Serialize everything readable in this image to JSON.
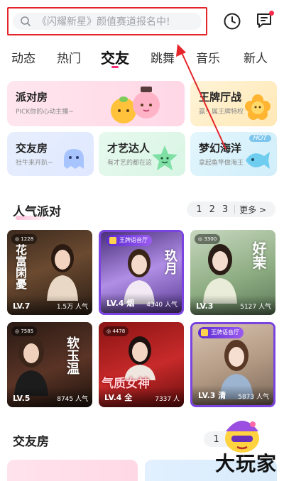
{
  "search": {
    "placeholder": "《闪耀新星》颜值赛道报名中!"
  },
  "header": {
    "history_icon": "clock-icon",
    "message_icon": "message-icon"
  },
  "tabs": [
    "动态",
    "热门",
    "交友",
    "跳舞",
    "音乐",
    "新人"
  ],
  "active_tab": "交友",
  "categories": [
    {
      "title": "派对房",
      "subtitle": "PICK你的心动主播~"
    },
    {
      "title": "王牌厅战",
      "subtitle": "赢！属王牌特权"
    },
    {
      "title": "交友房",
      "subtitle": "社牛来开趴~"
    },
    {
      "title": "才艺达人",
      "subtitle": "有才艺的都在这"
    },
    {
      "title": "梦幻海洋",
      "subtitle": "拿起鱼竿做海王",
      "badge": "HOT"
    }
  ],
  "popular_party": {
    "title": "人气派对",
    "pager": {
      "pages": [
        "1",
        "2",
        "3"
      ],
      "more": "更多 >"
    },
    "rooms": [
      {
        "level": "LV.7",
        "popularity": "1.5万 人气",
        "glyph": "花富閑憂",
        "tag": "",
        "king": false
      },
      {
        "level": "LV.4 烟",
        "popularity": "4340 人气",
        "glyph": "玖月",
        "tag": "",
        "king": true,
        "king_label": "王牌语音厅"
      },
      {
        "level": "LV.3",
        "popularity": "5127 人气",
        "glyph": "好茉",
        "tag": "",
        "king": false
      },
      {
        "level": "LV.5",
        "popularity": "8745 人气",
        "glyph": "软玉温",
        "tag": "",
        "king": false
      },
      {
        "level": "LV.4 全",
        "popularity": "7337 人",
        "glyph": "气质女神",
        "tag": "",
        "king": false
      },
      {
        "level": "LV.3 清",
        "popularity": "5873 人气",
        "glyph": "",
        "tag": "",
        "king": true,
        "king_label": "王牌语音厅"
      }
    ]
  },
  "friends_room": {
    "title": "交友房",
    "pager": {
      "pages": [
        "1",
        "2"
      ]
    }
  },
  "watermark": "大玩家",
  "colors": {
    "accent": "#ff2c7a",
    "highlight": "#e5252a"
  }
}
